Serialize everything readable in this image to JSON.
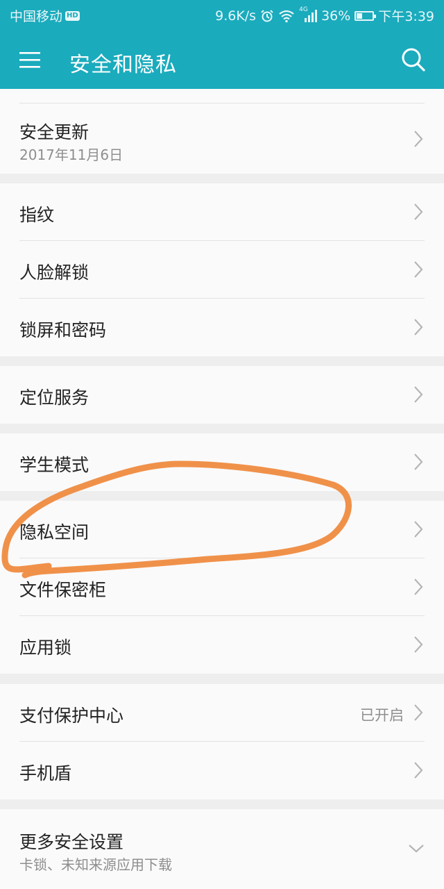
{
  "status_bar": {
    "carrier": "中国移动",
    "hd": "HD",
    "speed": "9.6K/s",
    "network": "4G",
    "battery": "36%",
    "battery_level": 0.36,
    "time": "下午3:39"
  },
  "app_bar": {
    "title": "安全和隐私",
    "menu_icon": "hamburger-menu-icon",
    "search_icon": "search-icon"
  },
  "groups": {
    "g0": [
      {
        "label": "安全更新",
        "sub": "2017年11月6日"
      }
    ],
    "g1": [
      {
        "label": "指纹"
      },
      {
        "label": "人脸解锁"
      },
      {
        "label": "锁屏和密码"
      }
    ],
    "g2": [
      {
        "label": "定位服务"
      }
    ],
    "g3": [
      {
        "label": "学生模式"
      },
      {
        "label": "隐私空间"
      },
      {
        "label": "文件保密柜"
      },
      {
        "label": "应用锁"
      }
    ],
    "g4": [
      {
        "label": "支付保护中心",
        "status": "已开启"
      },
      {
        "label": "手机盾"
      }
    ],
    "g5": [
      {
        "label": "更多安全设置",
        "sub": "卡锁、未知来源应用下载"
      }
    ]
  },
  "colors": {
    "accent": "#1aabbd",
    "annotation": "#f0914a"
  }
}
